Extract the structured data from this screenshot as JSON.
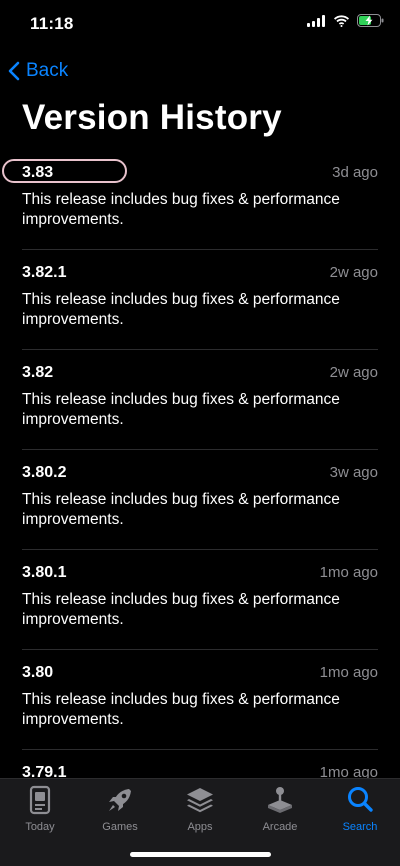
{
  "status_bar": {
    "time": "11:18"
  },
  "nav": {
    "back_label": "Back"
  },
  "page": {
    "title": "Version History"
  },
  "versions": [
    {
      "number": "3.83",
      "date": "3d ago",
      "notes": "This release includes bug fixes & performance improvements."
    },
    {
      "number": "3.82.1",
      "date": "2w ago",
      "notes": "This release includes bug fixes & performance improvements."
    },
    {
      "number": "3.82",
      "date": "2w ago",
      "notes": "This release includes bug fixes & performance improvements."
    },
    {
      "number": "3.80.2",
      "date": "3w ago",
      "notes": "This release includes bug fixes & performance improvements."
    },
    {
      "number": "3.80.1",
      "date": "1mo ago",
      "notes": "This release includes bug fixes & performance improvements."
    },
    {
      "number": "3.80",
      "date": "1mo ago",
      "notes": "This release includes bug fixes & performance improvements."
    },
    {
      "number": "3.79.1",
      "date": "1mo ago",
      "notes": ""
    }
  ],
  "tab_bar": {
    "tabs": [
      {
        "label": "Today",
        "icon": "today-icon",
        "active": false
      },
      {
        "label": "Games",
        "icon": "rocket-icon",
        "active": false
      },
      {
        "label": "Apps",
        "icon": "apps-stack-icon",
        "active": false
      },
      {
        "label": "Arcade",
        "icon": "joystick-icon",
        "active": false
      },
      {
        "label": "Search",
        "icon": "search-icon",
        "active": true
      }
    ]
  },
  "colors": {
    "background": "#000000",
    "accent": "#0a84ff",
    "secondary_text": "#8e8e93",
    "separator": "#2c2c2e",
    "highlight_ring": "#e8c2cc"
  }
}
